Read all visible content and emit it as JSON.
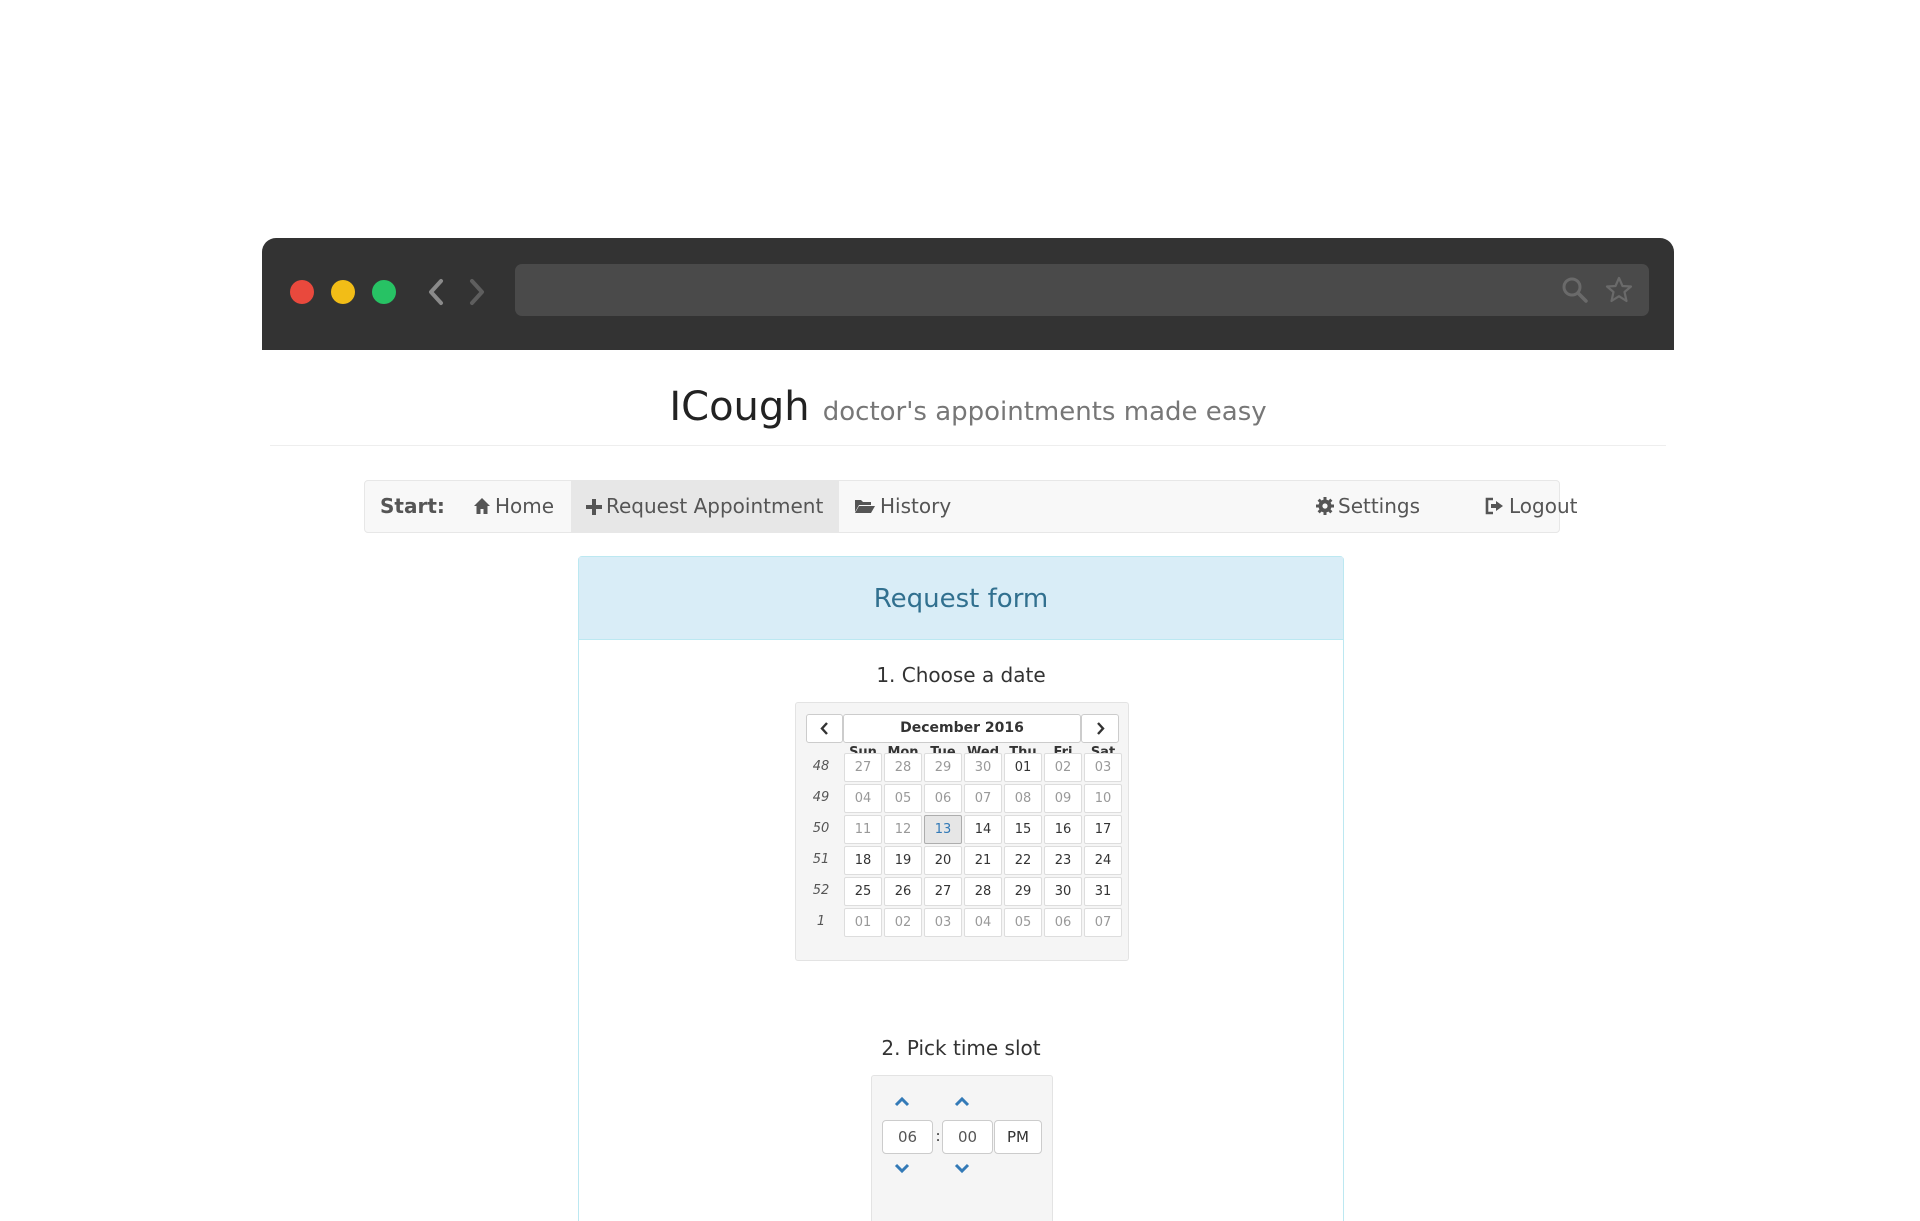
{
  "app": {
    "name": "ICough",
    "tagline": "doctor's appointments made easy"
  },
  "nav": {
    "start_label": "Start:",
    "items": [
      {
        "label": "Home",
        "icon": "home-icon"
      },
      {
        "label": "Request Appointment",
        "icon": "plus-icon",
        "active": true
      },
      {
        "label": "History",
        "icon": "folder-open-icon"
      },
      {
        "label": "Settings",
        "icon": "gear-icon"
      },
      {
        "label": "Logout",
        "icon": "logout-icon"
      }
    ]
  },
  "form": {
    "title": "Request form",
    "step1": "1. Choose a date",
    "step2": "2. Pick time slot"
  },
  "calendar": {
    "month_label": "December 2016",
    "weekdays": [
      "Sun",
      "Mon",
      "Tue",
      "Wed",
      "Thu",
      "Fri",
      "Sat"
    ],
    "weeks": [
      {
        "week": "48",
        "days": [
          {
            "d": "27",
            "muted": true
          },
          {
            "d": "28",
            "muted": true
          },
          {
            "d": "29",
            "muted": true
          },
          {
            "d": "30",
            "muted": true
          },
          {
            "d": "01",
            "muted": false
          },
          {
            "d": "02",
            "muted": true
          },
          {
            "d": "03",
            "muted": true
          }
        ]
      },
      {
        "week": "49",
        "days": [
          {
            "d": "04",
            "muted": true
          },
          {
            "d": "05",
            "muted": true
          },
          {
            "d": "06",
            "muted": true
          },
          {
            "d": "07",
            "muted": true
          },
          {
            "d": "08",
            "muted": true
          },
          {
            "d": "09",
            "muted": true
          },
          {
            "d": "10",
            "muted": true
          }
        ]
      },
      {
        "week": "50",
        "days": [
          {
            "d": "11",
            "muted": true
          },
          {
            "d": "12",
            "muted": true
          },
          {
            "d": "13",
            "muted": false,
            "today": true
          },
          {
            "d": "14",
            "muted": false
          },
          {
            "d": "15",
            "muted": false
          },
          {
            "d": "16",
            "muted": false
          },
          {
            "d": "17",
            "muted": false
          }
        ]
      },
      {
        "week": "51",
        "days": [
          {
            "d": "18",
            "muted": false
          },
          {
            "d": "19",
            "muted": false
          },
          {
            "d": "20",
            "muted": false
          },
          {
            "d": "21",
            "muted": false
          },
          {
            "d": "22",
            "muted": false
          },
          {
            "d": "23",
            "muted": false
          },
          {
            "d": "24",
            "muted": false
          }
        ]
      },
      {
        "week": "52",
        "days": [
          {
            "d": "25",
            "muted": false
          },
          {
            "d": "26",
            "muted": false
          },
          {
            "d": "27",
            "muted": false
          },
          {
            "d": "28",
            "muted": false
          },
          {
            "d": "29",
            "muted": false
          },
          {
            "d": "30",
            "muted": false
          },
          {
            "d": "31",
            "muted": false
          }
        ]
      },
      {
        "week": "1",
        "days": [
          {
            "d": "01",
            "muted": true
          },
          {
            "d": "02",
            "muted": true
          },
          {
            "d": "03",
            "muted": true
          },
          {
            "d": "04",
            "muted": true
          },
          {
            "d": "05",
            "muted": true
          },
          {
            "d": "06",
            "muted": true
          },
          {
            "d": "07",
            "muted": true
          }
        ]
      }
    ]
  },
  "time": {
    "hour": "06",
    "separator": ":",
    "minute": "00",
    "meridian": "PM"
  },
  "colors": {
    "chrome": "#333333",
    "accent": "#337ab7",
    "panel_heading": "#d9edf7",
    "panel_text": "#31708f"
  }
}
